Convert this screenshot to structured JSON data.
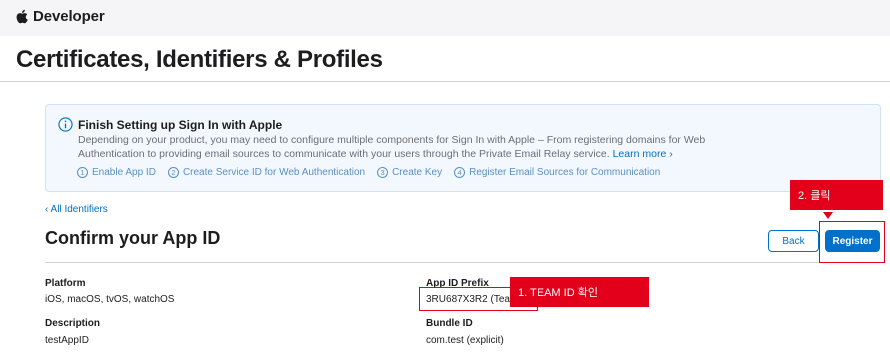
{
  "header": {
    "brand": "Developer",
    "logo_icon": "apple-logo-icon"
  },
  "page": {
    "title": "Certificates, Identifiers & Profiles"
  },
  "info": {
    "icon": "info-icon",
    "title": "Finish Setting up Sign In with Apple",
    "desc_line1": "Depending on your product, you may need to configure multiple components for Sign In with Apple – From registering domains for Web",
    "desc_line2": "Authentication to providing email sources to communicate with your users through the Private Email Relay service.",
    "learn_more": "Learn more ›",
    "steps": [
      {
        "num": "1",
        "label": "Enable App ID"
      },
      {
        "num": "2",
        "label": "Create Service ID for Web Authentication"
      },
      {
        "num": "3",
        "label": "Create Key"
      },
      {
        "num": "4",
        "label": "Register Email Sources for Communication"
      }
    ]
  },
  "nav": {
    "back_link": "‹ All Identifiers"
  },
  "confirm": {
    "title": "Confirm your App ID",
    "back_button": "Back",
    "register_button": "Register"
  },
  "fields": {
    "platform_label": "Platform",
    "platform_value": "iOS, macOS, tvOS, watchOS",
    "prefix_label": "App ID Prefix",
    "prefix_value": "3RU687X3R2 (Team ID)",
    "description_label": "Description",
    "description_value": "testAppID",
    "bundle_label": "Bundle ID",
    "bundle_value": "com.test (explicit)"
  },
  "annotations": {
    "team_id": "1. TEAM ID 확인",
    "click": "2. 클릭",
    "color": "#e2001a"
  },
  "colors": {
    "accent": "#0070c9",
    "info_bg": "#f2f8fd"
  }
}
